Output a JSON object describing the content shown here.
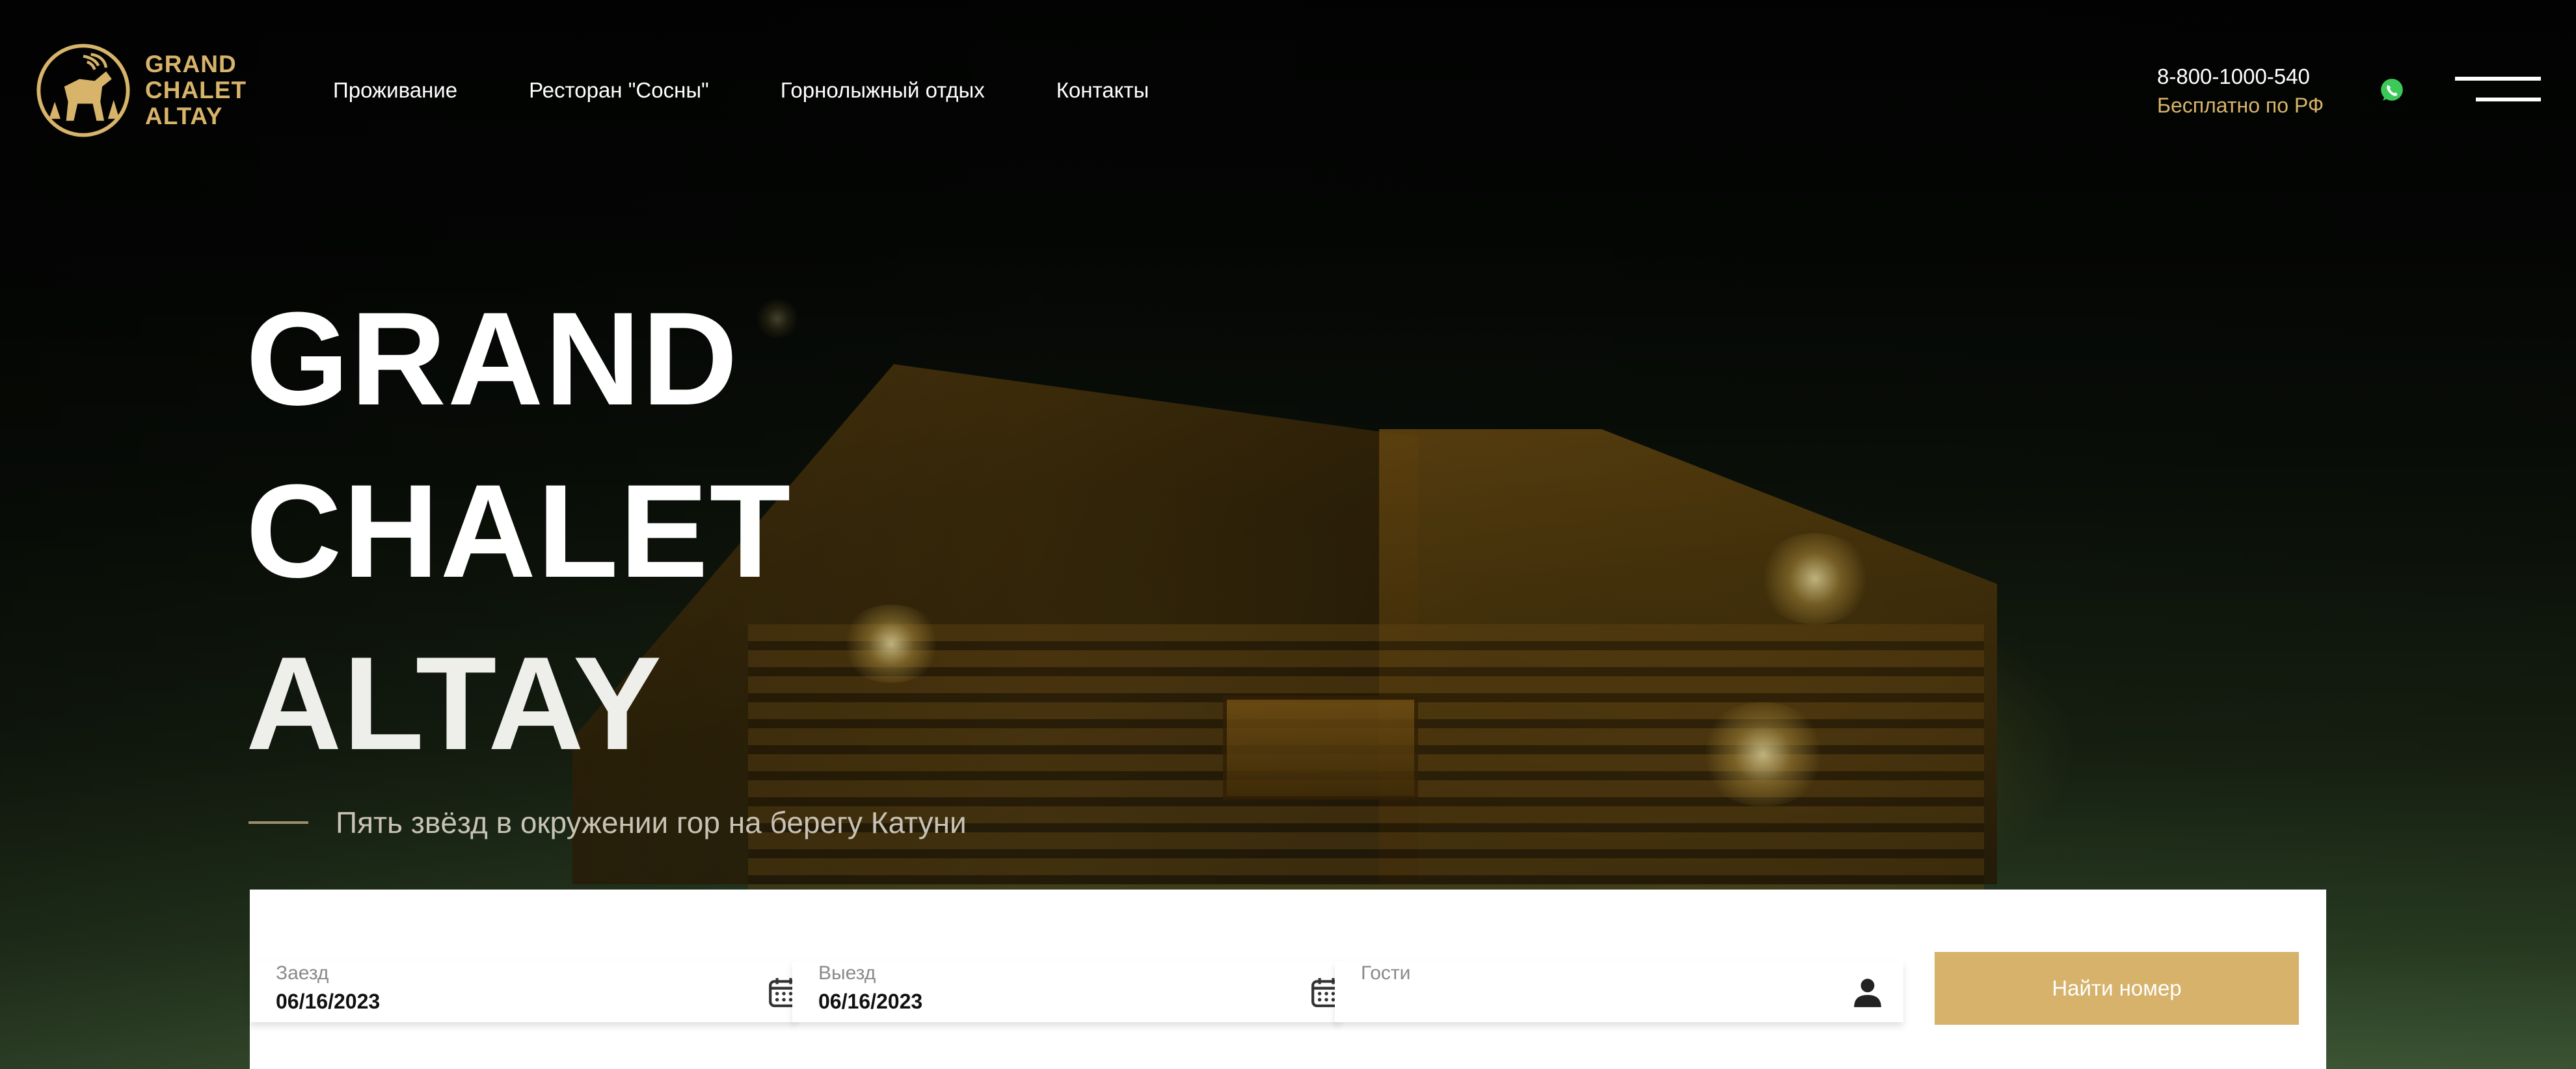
{
  "header": {
    "logo_lines": [
      "GRAND",
      "CHALET",
      "ALTAY"
    ],
    "nav": [
      {
        "label": "Проживание"
      },
      {
        "label": "Ресторан \"Сосны\""
      },
      {
        "label": "Горнолыжный отдых"
      },
      {
        "label": "Контакты"
      }
    ],
    "phone": "8-800-1000-540",
    "phone_note": "Бесплатно по РФ",
    "icons": {
      "whatsapp": "whatsapp-icon",
      "menu": "hamburger-menu-icon"
    }
  },
  "hero": {
    "title_lines": [
      "GRAND",
      "CHALET",
      "ALTAY"
    ],
    "subtitle": "Пять звёзд в окружении гор на берегу Катуни"
  },
  "booking": {
    "checkin": {
      "label": "Заезд",
      "value": "06/16/2023"
    },
    "checkout": {
      "label": "Выезд",
      "value": "06/16/2023"
    },
    "guests": {
      "label": "Гости",
      "value": ""
    },
    "search_label": "Найти номер"
  },
  "colors": {
    "accent_gold": "#d8b46a",
    "button_gold": "#d6b26a",
    "text_white": "#ffffff",
    "whatsapp_green": "#3cc957"
  }
}
